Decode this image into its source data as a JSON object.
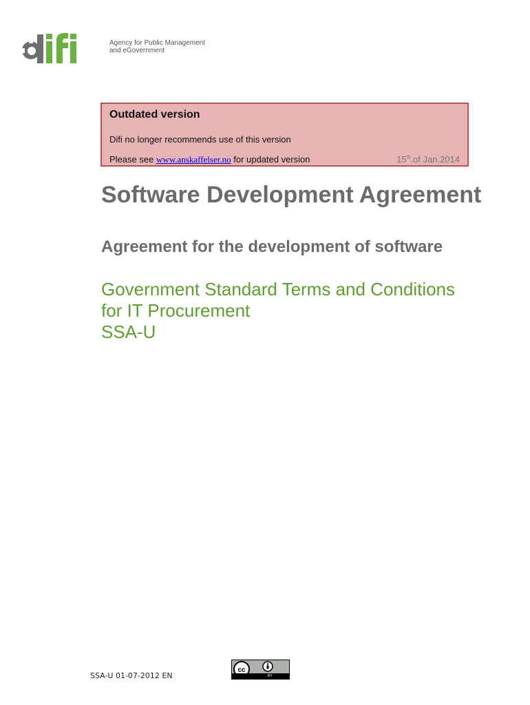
{
  "logo": {
    "wordmark": "difi",
    "tagline_line1": "Agency for Public Management",
    "tagline_line2": "and eGovernment"
  },
  "notice": {
    "title": "Outdated version",
    "line1": "Difi no longer recommends use of this version",
    "line2_prefix": "Please see ",
    "link_text": "www.anskaffelser.no",
    "line2_suffix": " for updated version",
    "date_day": "15",
    "date_suffix": "th",
    "date_rest": ".of Jan.2014"
  },
  "document": {
    "title": "Software Development Agreement",
    "subtitle": "Agreement for the development of software",
    "standard_line1": "Government Standard Terms and Conditions",
    "standard_line2": "for IT Procurement",
    "standard_line3": "SSA-U"
  },
  "footer": {
    "code": "SSA-U 01-07-2012 EN",
    "license_icon": "creative-commons-by-icon",
    "license_label": "BY"
  },
  "colors": {
    "logo_green": "#6ab23e",
    "logo_grey": "#6d6e70",
    "notice_bg": "#e6b4b4",
    "notice_border": "#c0504d",
    "title_grey": "#6b6b6b",
    "standard_green": "#5aa02c"
  }
}
